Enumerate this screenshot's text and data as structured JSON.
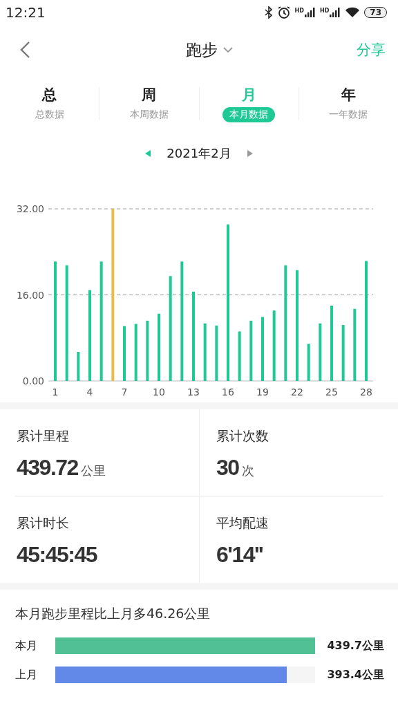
{
  "status_bar": {
    "time": "12:21",
    "signals": [
      "HD",
      "HD"
    ],
    "battery": "73"
  },
  "header": {
    "title": "跑步",
    "share": "分享"
  },
  "tabs": [
    {
      "label": "总",
      "sub": "总数据",
      "selected": false
    },
    {
      "label": "周",
      "sub": "本周数据",
      "selected": false
    },
    {
      "label": "月",
      "sub": "本月数据",
      "selected": true
    },
    {
      "label": "年",
      "sub": "一年数据",
      "selected": false
    }
  ],
  "period": {
    "label": "2021年2月"
  },
  "chart": {
    "chart_data": {
      "type": "bar",
      "x": [
        1,
        2,
        3,
        4,
        5,
        6,
        7,
        8,
        9,
        10,
        11,
        12,
        13,
        14,
        15,
        16,
        17,
        18,
        19,
        20,
        21,
        22,
        23,
        24,
        25,
        26,
        27,
        28
      ],
      "series": [
        {
          "color": "#1ec995",
          "values": [
            22.2,
            21.5,
            5.4,
            16.9,
            22.2,
            null,
            10.2,
            10.6,
            11.2,
            12.5,
            19.5,
            22.2,
            16.6,
            10.7,
            10.3,
            29.1,
            9.2,
            11.2,
            11.9,
            13.1,
            21.5,
            20.6,
            6.9,
            10.7,
            14.0,
            10.4,
            13.4,
            22.3
          ]
        },
        {
          "color": "#ecbc4a",
          "values": [
            null,
            null,
            null,
            null,
            null,
            32.0,
            null,
            null,
            null,
            null,
            null,
            null,
            null,
            null,
            null,
            null,
            null,
            null,
            null,
            null,
            null,
            null,
            null,
            null,
            null,
            null,
            null,
            null
          ]
        }
      ],
      "xlim": [
        1,
        28
      ],
      "xticks": [
        1,
        4,
        7,
        10,
        13,
        16,
        19,
        22,
        25,
        28
      ],
      "ylim": [
        0,
        32
      ],
      "yticks": [
        {
          "value": 0,
          "label": "0.00"
        },
        {
          "value": 16,
          "label": "16.00"
        },
        {
          "value": 32,
          "label": "32.00"
        }
      ]
    }
  },
  "stats": [
    {
      "label": "累计里程",
      "value": "439.72",
      "unit": "公里"
    },
    {
      "label": "累计次数",
      "value": "30",
      "unit": "次"
    },
    {
      "label": "累计时长",
      "value": "45:45:45"
    },
    {
      "label": "平均配速",
      "value": "6'14''"
    }
  ],
  "comparison": {
    "summary": "本月跑步里程比上月多46.26公里",
    "rows": [
      {
        "label": "本月",
        "level": 1.0,
        "value": "439.7公里",
        "color": "#52c095"
      },
      {
        "label": "上月",
        "level": 0.89,
        "value": "393.4公里",
        "color": "#6389e8"
      }
    ]
  }
}
